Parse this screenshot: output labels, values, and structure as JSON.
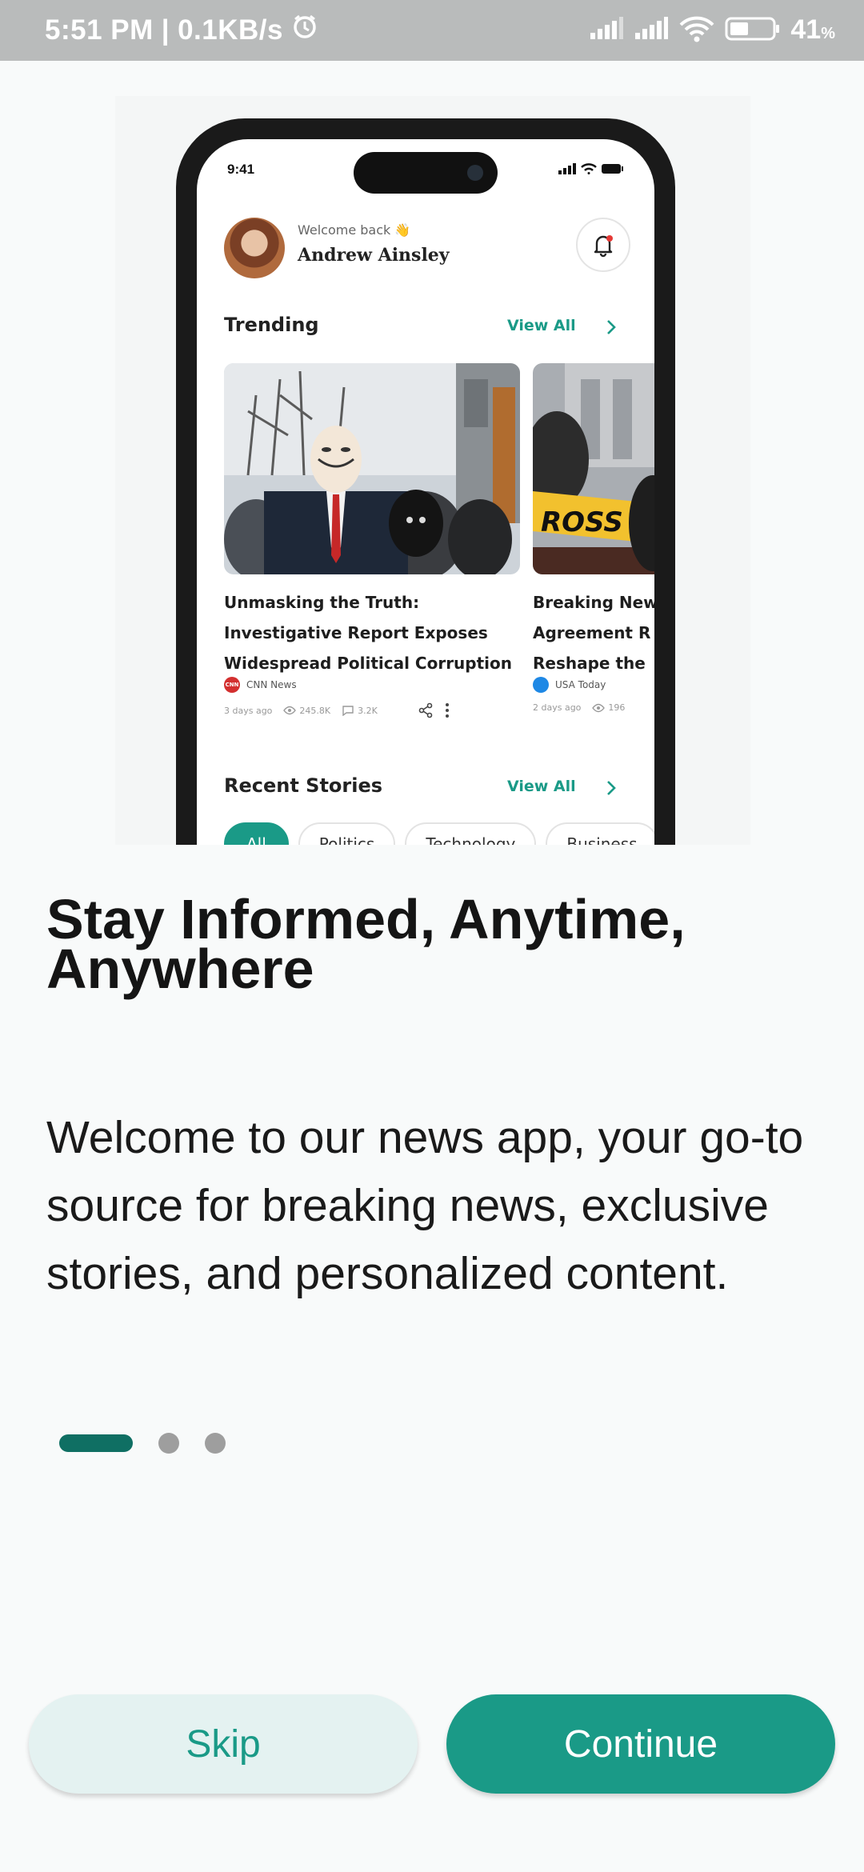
{
  "status_bar": {
    "time": "5:51 PM",
    "network_speed": "0.1KB/s",
    "battery_percent": "41",
    "battery_unit": "%",
    "icons": [
      "alarm-icon",
      "signal-icon",
      "signal-icon",
      "wifi-icon",
      "battery-icon"
    ]
  },
  "preview": {
    "time": "9:41",
    "welcome_label": "Welcome back 👋",
    "user_name": "Andrew Ainsley",
    "trending_title": "Trending",
    "view_all": "View All",
    "recent_title": "Recent Stories",
    "cards": [
      {
        "title_lines": [
          "Unmasking the Truth:",
          "Investigative Report Exposes",
          "Widespread Political Corruption"
        ],
        "source": "CNN News",
        "source_logo_text": "CNN",
        "age": "3 days ago",
        "views": "245.8K",
        "comments": "3.2K"
      },
      {
        "title_lines": [
          "Breaking New",
          "Agreement R",
          "Reshape the"
        ],
        "source": "USA Today",
        "age": "2 days ago",
        "views": "196"
      }
    ],
    "chips": [
      "All",
      "Politics",
      "Technology",
      "Business"
    ],
    "active_chip": "All"
  },
  "onboarding": {
    "headline_lines": [
      "Stay Informed, Anytime,",
      "Anywhere"
    ],
    "body": "Welcome to our news app, your go-to source for breaking news, exclusive stories, and personalized content.",
    "page_count": 3,
    "current_page": 1
  },
  "actions": {
    "skip_label": "Skip",
    "continue_label": "Continue"
  },
  "colors": {
    "accent": "#1a9a87",
    "accent_dark": "#0f6f63",
    "skip_bg": "#e4f2f1",
    "status_bar": "#b9bbbb"
  }
}
